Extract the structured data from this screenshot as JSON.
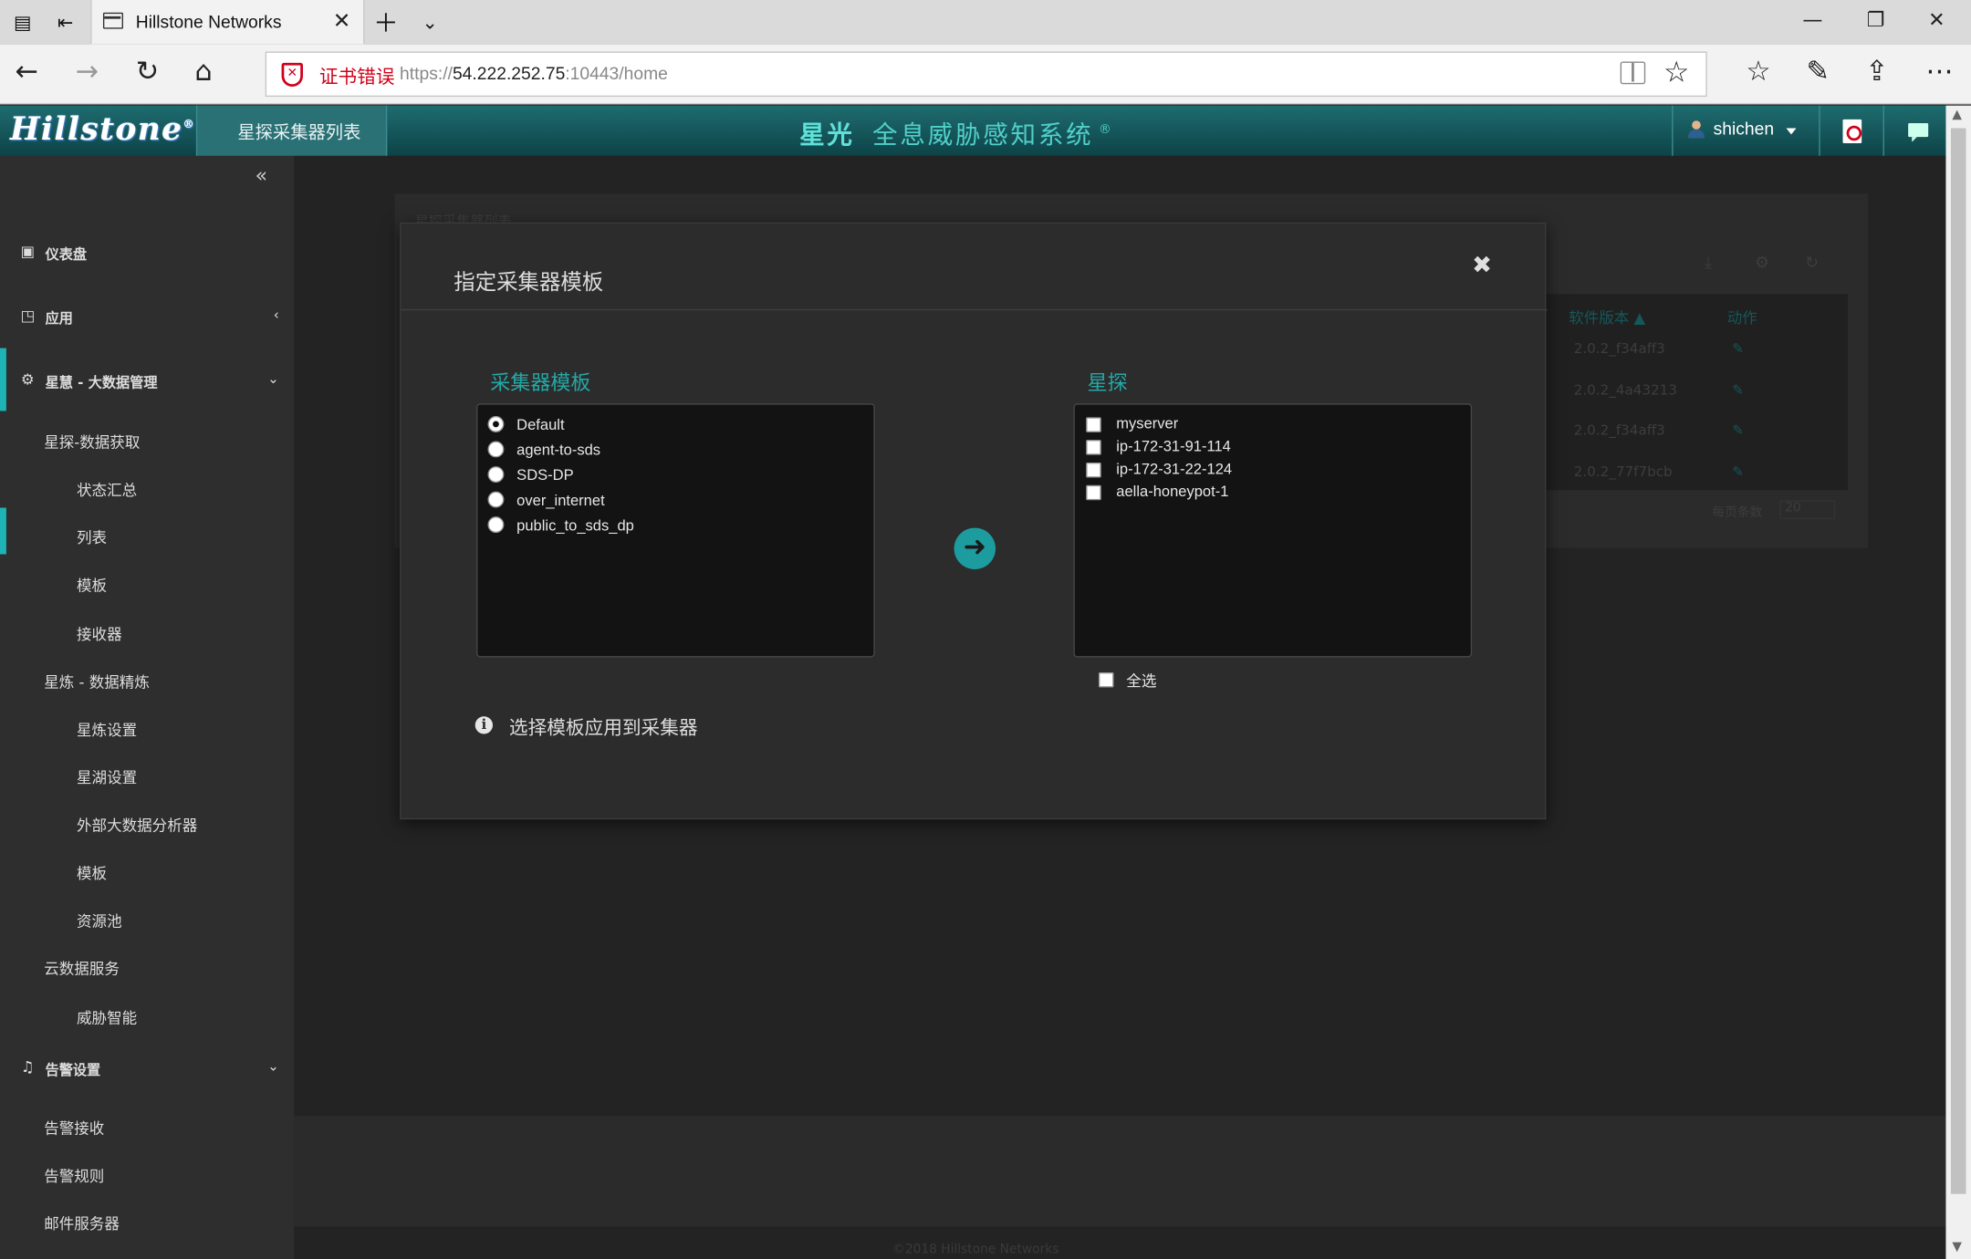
{
  "browser": {
    "tab_title": "Hillstone Networks",
    "cert_error": "证书错误",
    "url_prefix": "https://",
    "url_host": "54.222.252.75",
    "url_rest": ":10443/home"
  },
  "header": {
    "logo": "Hillstone",
    "active_tab": "星探采集器列表",
    "system_brand": "星光",
    "system_title": "全息威胁感知系统",
    "registered": "®",
    "user": "shichen"
  },
  "sidebar": {
    "items": [
      {
        "label": "仪表盘",
        "level": "top"
      },
      {
        "label": "应用",
        "level": "top"
      },
      {
        "label": "星慧 - 大数据管理",
        "level": "top"
      },
      {
        "label": "星探-数据获取",
        "level": "l1"
      },
      {
        "label": "状态汇总",
        "level": "l2"
      },
      {
        "label": "列表",
        "level": "l2"
      },
      {
        "label": "模板",
        "level": "l2"
      },
      {
        "label": "接收器",
        "level": "l2"
      },
      {
        "label": "星炼 - 数据精炼",
        "level": "l1"
      },
      {
        "label": "星炼设置",
        "level": "l2"
      },
      {
        "label": "星湖设置",
        "level": "l2"
      },
      {
        "label": "外部大数据分析器",
        "level": "l2"
      },
      {
        "label": "模板",
        "level": "l2"
      },
      {
        "label": "资源池",
        "level": "l2"
      },
      {
        "label": "云数据服务",
        "level": "l1"
      },
      {
        "label": "威胁智能",
        "level": "l2"
      },
      {
        "label": "告警设置",
        "level": "top"
      },
      {
        "label": "告警接收",
        "level": "l1"
      },
      {
        "label": "告警规则",
        "level": "l1"
      },
      {
        "label": "邮件服务器",
        "level": "l1"
      }
    ]
  },
  "background": {
    "panel_title": "星探采集器列表",
    "col_version": "软件版本 ▲",
    "col_action": "动作",
    "versions": [
      "2.0.2_f34aff3",
      "2.0.2_4a43213",
      "2.0.2_f34aff3",
      "2.0.2_77f7bcb"
    ],
    "page_size_label": "每页条数",
    "page_size": "20",
    "footer": "©2018 Hillstone Networks"
  },
  "modal": {
    "title": "指定采集器模板",
    "close": "✖",
    "templates_title": "采集器模板",
    "templates": [
      "Default",
      "agent-to-sds",
      "SDS-DP",
      "over_internet",
      "public_to_sds_dp"
    ],
    "selected_template": "Default",
    "probes_title": "星探",
    "probes": [
      "myserver",
      "ip-172-31-91-114",
      "ip-172-31-22-124",
      "aella-honeypot-1"
    ],
    "select_all": "全选",
    "info": "选择模板应用到采集器"
  }
}
